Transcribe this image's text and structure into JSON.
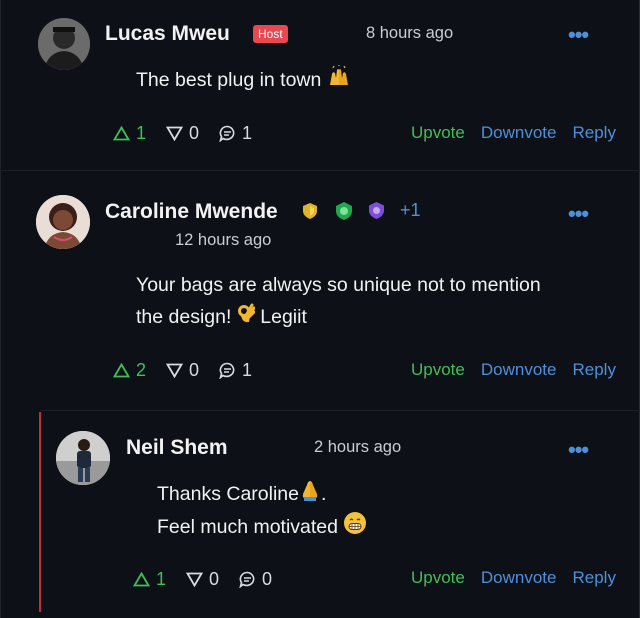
{
  "comments": [
    {
      "author": "Lucas Mweu",
      "badge": "Host",
      "time": "8 hours ago",
      "more": "•••",
      "text": "The best plug in town",
      "emoji": "raising-hands",
      "upvotes": "1",
      "downvotes": "0",
      "replies": "1"
    },
    {
      "author": "Caroline Mwende",
      "extra_badges": "+1",
      "time": "12 hours ago",
      "more": "•••",
      "text_line1": "Your bags are always so unique not to mention",
      "text_line2_a": "the design!",
      "text_line2_b": " Legiit",
      "emoji": "ok-hand",
      "upvotes": "2",
      "downvotes": "0",
      "replies": "1"
    },
    {
      "author": "Neil Shem",
      "time": "2 hours ago",
      "more": "•••",
      "text_line1": "Thanks Caroline",
      "text_line1_end": ".",
      "text_line2": "Feel much motivated",
      "emoji1": "folded-hands",
      "emoji2": "grinning-face",
      "upvotes": "1",
      "downvotes": "0",
      "replies": "0"
    }
  ],
  "actions": {
    "upvote": "Upvote",
    "downvote": "Downvote",
    "reply": "Reply"
  },
  "colors": {
    "background": "#0d1117",
    "upvote_green": "#3fbf58",
    "link_blue": "#4f8fd9",
    "host_red": "#e8484f",
    "thread_red": "#c0303b"
  }
}
